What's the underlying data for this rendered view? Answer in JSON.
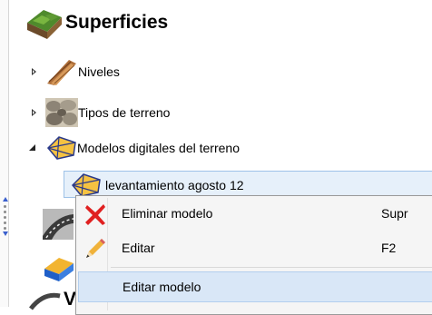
{
  "tree": {
    "root": {
      "label": "Superficies",
      "icon": "terrain-surface-icon"
    },
    "children": [
      {
        "label": "Niveles",
        "icon": "wood-levels-icon",
        "expander": "collapsed"
      },
      {
        "label": "Tipos de terreno",
        "icon": "stones-terrain-icon",
        "expander": "collapsed"
      },
      {
        "label": "Modelos digitales del terreno",
        "icon": "tin-model-icon",
        "expander": "expanded"
      },
      {
        "label": "levantamiento agosto 12",
        "icon": "tin-model-icon",
        "selected": true
      },
      {
        "label": "",
        "icon": "road-icon"
      },
      {
        "label": "",
        "icon": "solid-block-icon"
      },
      {
        "label": "V",
        "icon": "curve-icon"
      }
    ]
  },
  "context_menu": {
    "items": [
      {
        "label": "Eliminar modelo",
        "shortcut": "Supr",
        "icon": "delete-x-icon"
      },
      {
        "label": "Editar",
        "shortcut": "F2",
        "icon": "pencil-icon"
      },
      {
        "label": "Editar modelo",
        "shortcut": "",
        "icon": "",
        "highlighted": true
      }
    ]
  },
  "colors": {
    "menu_highlight": "#d9e7f7",
    "selection": "#e6f0fa",
    "splitter_arrow": "#3a5fcd",
    "delete_icon": "#e02020"
  }
}
